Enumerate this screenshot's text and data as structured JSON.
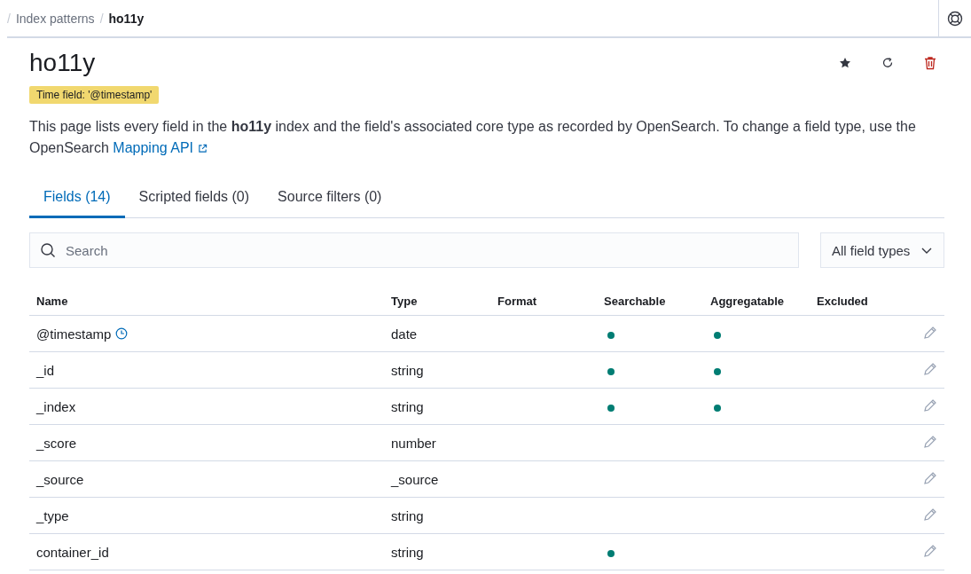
{
  "breadcrumb_separator": "/",
  "breadcrumbs": [
    {
      "label": "Index patterns",
      "current": false
    },
    {
      "label": "ho11y",
      "current": true
    }
  ],
  "title": "ho11y",
  "time_badge": "Time field: '@timestamp'",
  "description": "This page lists every field in the **ho11y** index and the field's associated core type as recorded by OpenSearch. To change a field type, use the OpenSearch",
  "description_link": "Mapping API",
  "tabs": [
    {
      "label": "Fields (14)",
      "selected": true
    },
    {
      "label": "Scripted fields (0)",
      "selected": false
    },
    {
      "label": "Source filters (0)",
      "selected": false
    }
  ],
  "search": {
    "placeholder": "Search"
  },
  "type_filter": "All field types",
  "table": {
    "columns": [
      "Name",
      "Type",
      "Format",
      "Searchable",
      "Aggregatable",
      "Excluded"
    ],
    "rows": [
      {
        "name": "@timestamp",
        "time_field": true,
        "type": "date",
        "searchable": true,
        "aggregatable": true
      },
      {
        "name": "_id",
        "time_field": false,
        "type": "string",
        "searchable": true,
        "aggregatable": true
      },
      {
        "name": "_index",
        "time_field": false,
        "type": "string",
        "searchable": true,
        "aggregatable": true
      },
      {
        "name": "_score",
        "time_field": false,
        "type": "number",
        "searchable": false,
        "aggregatable": false
      },
      {
        "name": "_source",
        "time_field": false,
        "type": "_source",
        "searchable": false,
        "aggregatable": false
      },
      {
        "name": "_type",
        "time_field": false,
        "type": "string",
        "searchable": false,
        "aggregatable": false
      },
      {
        "name": "container_id",
        "time_field": false,
        "type": "string",
        "searchable": true,
        "aggregatable": false
      }
    ]
  }
}
